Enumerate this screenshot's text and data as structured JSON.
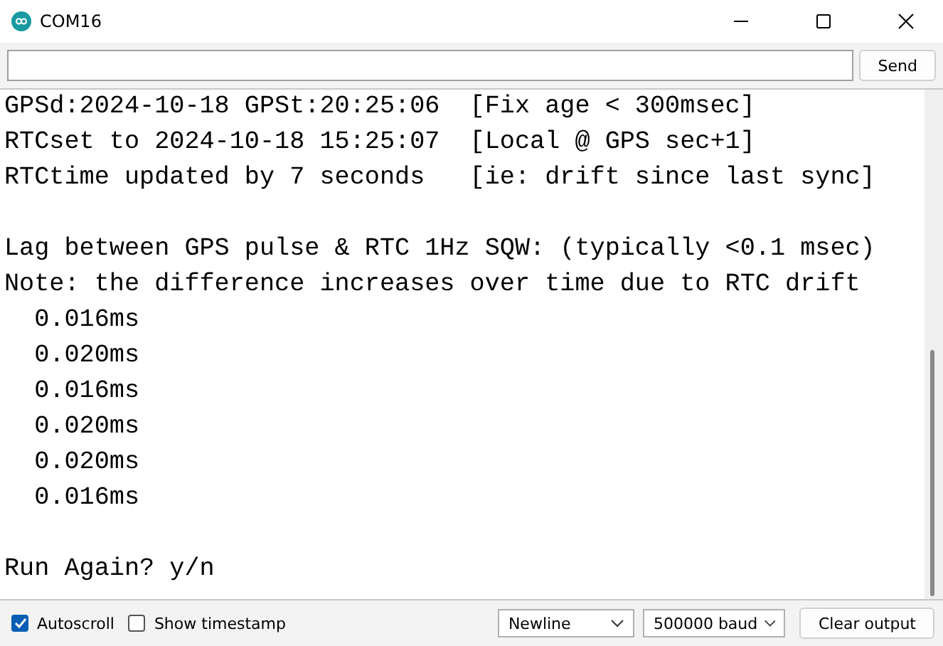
{
  "window": {
    "title": "COM16"
  },
  "send_bar": {
    "button": "Send"
  },
  "output_blocks": [
    [
      "GPSd:2024-10-18 GPSt:20:25:06  [Fix age < 300msec]",
      "RTCset to 2024-10-18 15:25:07  [Local @ GPS sec+1]",
      "RTCtime updated by 7 seconds   [ie: drift since last sync]"
    ],
    [
      "Lag between GPS pulse & RTC 1Hz SQW: (typically <0.1 msec)",
      "Note: the difference increases over time due to RTC drift",
      "  0.016ms",
      "  0.020ms",
      "  0.016ms",
      "  0.020ms",
      "  0.020ms",
      "  0.016ms"
    ],
    [
      "Run Again? y/n"
    ]
  ],
  "footer": {
    "autoscroll": {
      "label": "Autoscroll",
      "checked": true
    },
    "timestamp": {
      "label": "Show timestamp",
      "checked": false
    },
    "line_ending": "Newline",
    "baud": "500000 baud",
    "clear_button": "Clear output"
  }
}
